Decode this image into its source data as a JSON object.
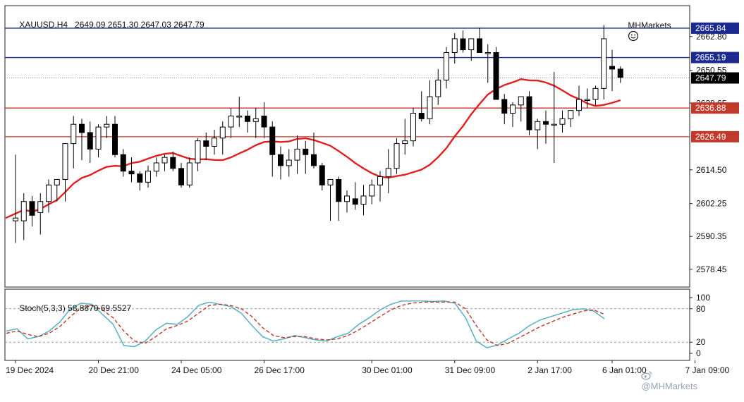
{
  "header": {
    "symbol": "XAUUSD,H4",
    "open": "2649.09",
    "high": "2651.30",
    "low": "2647.03",
    "close": "2647.79"
  },
  "broker": {
    "name": "MHMarkets",
    "icon": "smiley-face-icon"
  },
  "watermark": {
    "text": "@MHMarkets",
    "icon": "weibo-icon"
  },
  "colors": {
    "up_candle": "#ffffff",
    "down_candle": "#000000",
    "ma_line": "#e02020",
    "resistance_line": "#1c2a8f",
    "support_line": "#c0392b",
    "stoch_main": "#5fb3c6",
    "stoch_signal": "#c0392b",
    "price_tag_bg": "#000000"
  },
  "chart_data": [
    {
      "type": "candlestick",
      "title": "XAUUSD,H4",
      "ylim": [
        2572,
        2674
      ],
      "y_ticks": [
        "2662.80",
        "2650.55",
        "2638.65",
        "2614.50",
        "2602.25",
        "2590.35",
        "2578.45"
      ],
      "x_ticks": [
        "19 Dec 2024",
        "20 Dec 21:00",
        "24 Dec 05:00",
        "26 Dec 17:00",
        "30 Dec 01:00",
        "31 Dec 09:00",
        "2 Jan 17:00",
        "6 Jan 01:00",
        "7 Jan 09:00"
      ],
      "x_tick_index": [
        0,
        10,
        20,
        30,
        43,
        53,
        63,
        72,
        82
      ],
      "candles": [
        [
          2596,
          2620,
          2588,
          2597
        ],
        [
          2596,
          2606,
          2589,
          2603
        ],
        [
          2603,
          2605,
          2594,
          2598
        ],
        [
          2599,
          2606,
          2591,
          2603
        ],
        [
          2603,
          2611,
          2599,
          2609
        ],
        [
          2609,
          2610,
          2603,
          2611
        ],
        [
          2611,
          2620,
          2603,
          2624
        ],
        [
          2624,
          2634,
          2615,
          2631
        ],
        [
          2631,
          2633,
          2618,
          2628
        ],
        [
          2628,
          2632,
          2617,
          2622
        ],
        [
          2622,
          2631,
          2619,
          2630
        ],
        [
          2630,
          2634,
          2626,
          2631
        ],
        [
          2631,
          2634,
          2619,
          2620
        ],
        [
          2620,
          2622,
          2612,
          2614
        ],
        [
          2614,
          2619,
          2610,
          2613
        ],
        [
          2613,
          2614,
          2607,
          2610
        ],
        [
          2610,
          2616,
          2608,
          2614
        ],
        [
          2614,
          2619,
          2612,
          2617
        ],
        [
          2617,
          2620,
          2614,
          2619
        ],
        [
          2619,
          2621,
          2614,
          2615
        ],
        [
          2615,
          2617,
          2608,
          2609
        ],
        [
          2609,
          2619,
          2608,
          2617
        ],
        [
          2617,
          2626,
          2614,
          2625
        ],
        [
          2625,
          2628,
          2618,
          2623
        ],
        [
          2623,
          2629,
          2620,
          2626
        ],
        [
          2626,
          2632,
          2620,
          2630
        ],
        [
          2630,
          2637,
          2626,
          2634
        ],
        [
          2634,
          2641,
          2630,
          2634
        ],
        [
          2634,
          2636,
          2628,
          2632
        ],
        [
          2632,
          2637,
          2626,
          2633
        ],
        [
          2634,
          2639,
          2626,
          2630
        ],
        [
          2630,
          2632,
          2612,
          2620
        ],
        [
          2620,
          2623,
          2611,
          2616
        ],
        [
          2616,
          2622,
          2612,
          2618
        ],
        [
          2618,
          2627,
          2613,
          2622
        ],
        [
          2622,
          2625,
          2613,
          2620
        ],
        [
          2620,
          2628,
          2615,
          2616
        ],
        [
          2616,
          2617,
          2607,
          2609
        ],
        [
          2609,
          2611,
          2596,
          2611
        ],
        [
          2611,
          2612,
          2596,
          2603
        ],
        [
          2603,
          2607,
          2599,
          2605
        ],
        [
          2604,
          2610,
          2600,
          2602
        ],
        [
          2602,
          2609,
          2598,
          2605
        ],
        [
          2605,
          2611,
          2602,
          2609
        ],
        [
          2609,
          2614,
          2603,
          2612
        ],
        [
          2612,
          2622,
          2606,
          2615
        ],
        [
          2615,
          2626,
          2613,
          2624
        ],
        [
          2624,
          2633,
          2620,
          2625
        ],
        [
          2625,
          2637,
          2623,
          2635
        ],
        [
          2635,
          2643,
          2632,
          2633
        ],
        [
          2633,
          2647,
          2631,
          2641
        ],
        [
          2641,
          2651,
          2638,
          2647
        ],
        [
          2647,
          2659,
          2644,
          2657
        ],
        [
          2657,
          2664,
          2653,
          2662
        ],
        [
          2662,
          2665,
          2657,
          2658
        ],
        [
          2658,
          2661,
          2654,
          2662
        ],
        [
          2662,
          2666,
          2659,
          2657
        ],
        [
          2657,
          2660,
          2646,
          2657
        ],
        [
          2657,
          2659,
          2643,
          2640
        ],
        [
          2640,
          2642,
          2631,
          2635
        ],
        [
          2635,
          2639,
          2630,
          2638
        ],
        [
          2638,
          2641,
          2632,
          2641
        ],
        [
          2641,
          2643,
          2627,
          2629
        ],
        [
          2629,
          2633,
          2622,
          2632
        ],
        [
          2632,
          2636,
          2624,
          2631
        ],
        [
          2631,
          2650,
          2617,
          2631
        ],
        [
          2631,
          2636,
          2628,
          2633
        ],
        [
          2633,
          2636,
          2630,
          2636
        ],
        [
          2636,
          2645,
          2634,
          2640
        ],
        [
          2640,
          2644,
          2637,
          2640
        ],
        [
          2640,
          2645,
          2638,
          2644
        ],
        [
          2644,
          2667,
          2640,
          2662
        ],
        [
          2652,
          2658,
          2643,
          2651
        ],
        [
          2651,
          2652,
          2646,
          2648
        ]
      ]
    },
    {
      "type": "line",
      "title": "Stoch(5,3,3) 58.8870 69.5527",
      "ylim": [
        0,
        100
      ],
      "y_ticks": [
        "100",
        "80",
        "20",
        "0"
      ],
      "levels": [
        80,
        20
      ],
      "series": [
        {
          "values": [
            40,
            44,
            26,
            30,
            40,
            56,
            80,
            90,
            88,
            70,
            52,
            14,
            12,
            22,
            42,
            54,
            52,
            66,
            86,
            92,
            88,
            84,
            72,
            50,
            30,
            22,
            26,
            32,
            28,
            24,
            22,
            30,
            36,
            52,
            64,
            78,
            88,
            94,
            94,
            94,
            93,
            94,
            90,
            64,
            22,
            10,
            15,
            26,
            36,
            50,
            60,
            66,
            72,
            78,
            80,
            76,
            62
          ]
        },
        {
          "values": [
            36,
            40,
            34,
            30,
            36,
            48,
            66,
            82,
            86,
            78,
            64,
            40,
            22,
            18,
            30,
            44,
            50,
            58,
            72,
            86,
            88,
            86,
            80,
            66,
            46,
            32,
            28,
            30,
            30,
            26,
            24,
            26,
            32,
            42,
            54,
            66,
            78,
            86,
            90,
            92,
            92,
            92,
            92,
            80,
            50,
            24,
            14,
            18,
            28,
            38,
            48,
            56,
            64,
            70,
            76,
            78,
            70
          ]
        }
      ]
    }
  ],
  "levels": {
    "resistance": [
      "2665.84",
      "2655.19"
    ],
    "support": [
      "2636.88",
      "2626.49"
    ],
    "current": "2647.79"
  }
}
